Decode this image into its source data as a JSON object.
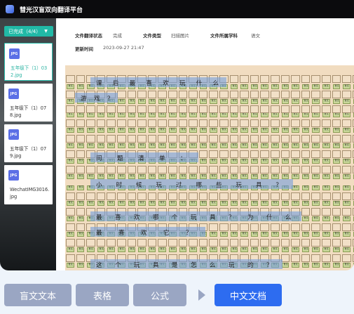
{
  "window": {
    "title": "彗光汉盲双向翻译平台"
  },
  "sidebar": {
    "status_filter": "已完成（4/4）",
    "files": [
      {
        "name": "五年级下（1）032.jpg",
        "type": "JPG",
        "active": true
      },
      {
        "name": "五年级下（1）078.jpg",
        "type": "JPG",
        "active": false
      },
      {
        "name": "五年级下（1）079.jpg",
        "type": "JPG",
        "active": false
      },
      {
        "name": "WechatIMG3016.jpg",
        "type": "JPG",
        "active": false
      }
    ]
  },
  "info": {
    "translate_status_label": "文件翻译状态",
    "translate_status_value": "完成",
    "file_type_label": "文件类型",
    "file_type_value": "扫描图片",
    "subject_label": "文件所属学科",
    "subject_value": "语文",
    "updated_label": "更新时间",
    "updated_value": "2023-09-27 21:47"
  },
  "document": {
    "green_label": "盲文",
    "lines": [
      {
        "chars": [
          "课",
          "后",
          "最",
          "喜",
          "欢",
          "玩",
          "什",
          "么"
        ]
      },
      {
        "chars": [
          "游",
          "戏",
          "？"
        ]
      },
      {
        "chars": [
          "问",
          "题",
          "清",
          "单",
          "："
        ]
      },
      {
        "chars": [
          "小",
          "时",
          "候",
          "玩",
          "过",
          "哪",
          "些",
          "玩",
          "具",
          "？"
        ]
      },
      {
        "chars": [
          "最",
          "喜",
          "欢",
          "哪",
          "个",
          "玩",
          "具",
          "？",
          "为",
          "什",
          "么"
        ]
      },
      {
        "chars": [
          "最",
          "喜",
          "欢",
          "它",
          "？"
        ]
      },
      {
        "chars": [
          "这",
          "个",
          "玩",
          "具",
          "是",
          "怎",
          "么",
          "玩",
          "的",
          "？"
        ]
      }
    ]
  },
  "tabs": [
    {
      "label": "盲文文本",
      "active": false
    },
    {
      "label": "表格",
      "active": false
    },
    {
      "label": "公式",
      "active": false
    },
    {
      "label": "中文文档",
      "active": true
    }
  ],
  "colors": {
    "accent_teal": "#21b9a6",
    "active_tab": "#2d6cf0",
    "inactive_tab": "#9aa6c3"
  }
}
